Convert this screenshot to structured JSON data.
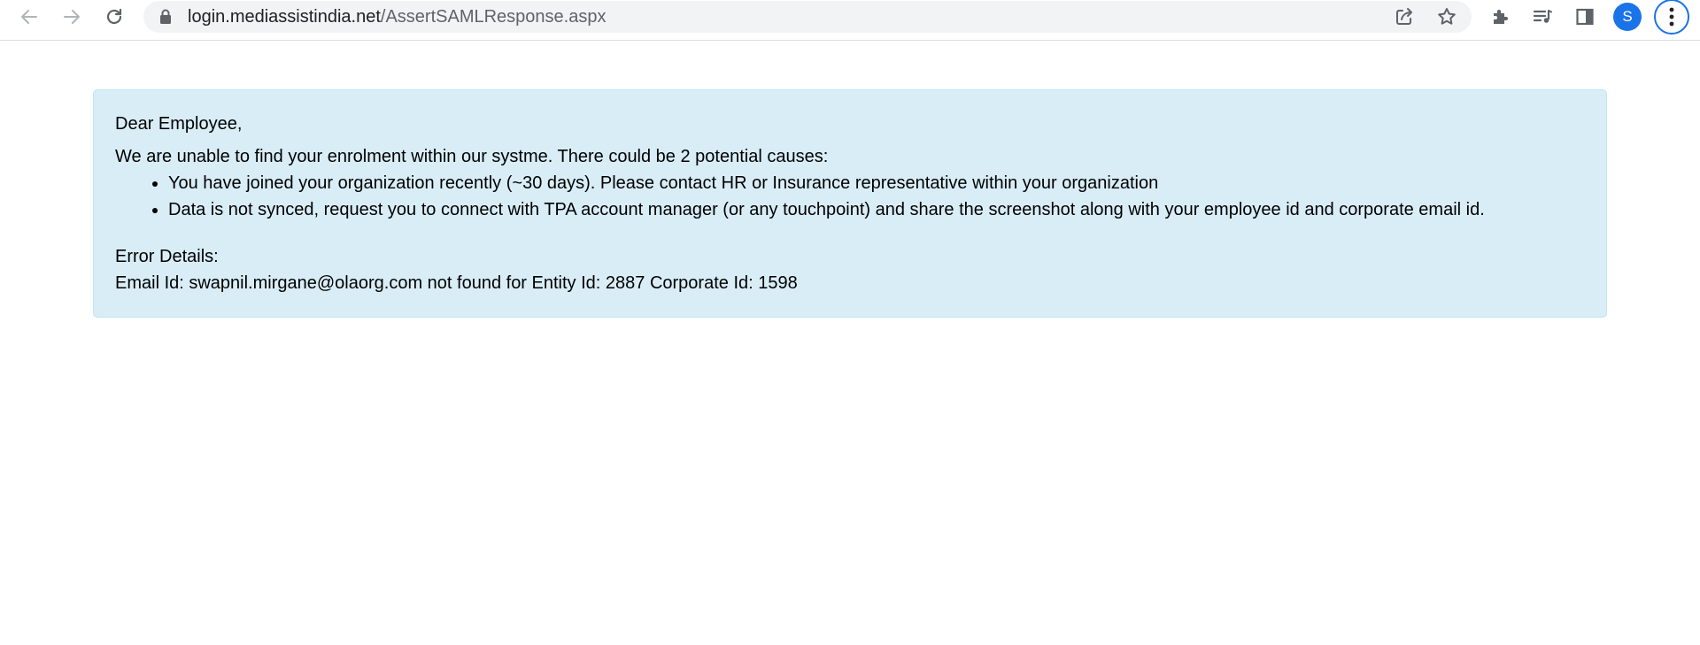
{
  "browser": {
    "url_host": "login.mediassistindia.net",
    "url_path": "/AssertSAMLResponse.aspx",
    "profile_initial": "S",
    "accent_color": "#1a73e8",
    "icons": {
      "back": "arrow-left-icon",
      "forward": "arrow-right-icon",
      "reload": "reload-icon",
      "lock": "lock-icon",
      "share": "share-icon",
      "bookmark": "star-icon",
      "extensions": "puzzle-icon",
      "media": "media-queue-icon",
      "side_panel": "side-panel-icon",
      "menu": "kebab-menu-icon"
    }
  },
  "message": {
    "greeting": "Dear Employee,",
    "intro": "We are unable to find your enrolment within our systme. There could be 2 potential causes:",
    "causes": [
      "You have joined your organization recently (~30 days). Please contact HR or Insurance representative within your organization",
      "Data is not synced, request you to connect with TPA account manager (or any touchpoint) and share the screenshot along with your employee id and corporate email id."
    ],
    "error_title": "Error Details:",
    "error_detail": "Email Id: swapnil.mirgane@olaorg.com not found for Entity Id: 2887 Corporate Id: 1598",
    "background_color": "#d9edf7",
    "border_color": "#bce8f1"
  }
}
